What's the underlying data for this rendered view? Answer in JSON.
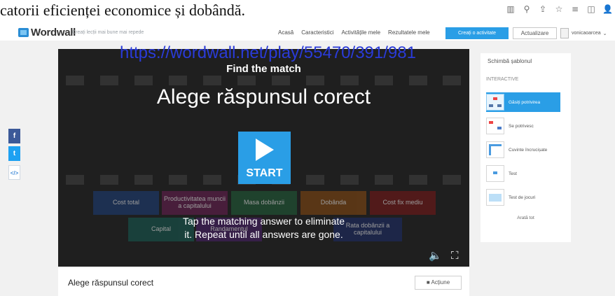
{
  "document": {
    "text": "catorii eficienței economice și dobândă."
  },
  "browser_toolbar": {
    "icons": [
      "reader-icon",
      "zoom-icon",
      "share-icon",
      "star-icon",
      "reading-list-icon",
      "split-icon",
      "profile-icon"
    ],
    "glyphs": [
      "▥",
      "⚲",
      "⇪",
      "☆",
      "≡",
      "◫",
      "👤"
    ]
  },
  "wordwall_header": {
    "logo_text": "Wordwall",
    "tagline": "Creați lecții mai bune mai repede",
    "nav": [
      "Acasă",
      "Caracteristici",
      "Activitățile mele",
      "Rezultatele mele"
    ],
    "create_button": "Creați o activitate",
    "update_button": "Actualizare",
    "user_name": "vonicaoarcea",
    "user_chevron": "⌄"
  },
  "share": {
    "facebook": "f",
    "twitter": "t",
    "embed": "</>"
  },
  "activity": {
    "subtitle": "Find the match",
    "title": "Alege răspunsul corect",
    "start_label": "START",
    "instructions_line1": "Tap the matching answer to eliminate",
    "instructions_line2": "it. Repeat until all answers are gone.",
    "sound_icon": "🔈",
    "fullscreen_icon": "⛶",
    "ghost_tiles": [
      "Cost total",
      "Productivitatea muncii a capitalului",
      "Masa dobânzii",
      "Dobânda",
      "Cost fix mediu",
      "Capital",
      "Randamentul",
      "Rata dobânzii a capitalului"
    ]
  },
  "overlay_url": "https://wordwall.net/play/55470/391/981",
  "sidebar": {
    "title": "Schimbă șablonul",
    "section": "INTERACTIVE",
    "templates": [
      "Găsiți potrivirea",
      "Se potrivesc",
      "Cuvinte încrucișate",
      "Test",
      "Test de jocuri"
    ],
    "show_all": "Arată tot"
  },
  "below": {
    "title": "Alege răspunsul corect",
    "action_button": "Acțiune"
  },
  "colors": {
    "accent": "#2a9ee6",
    "player_bg": "#1f1f1f",
    "facebook": "#3b5998",
    "twitter": "#1da1f2",
    "url": "#2a3bd8"
  }
}
